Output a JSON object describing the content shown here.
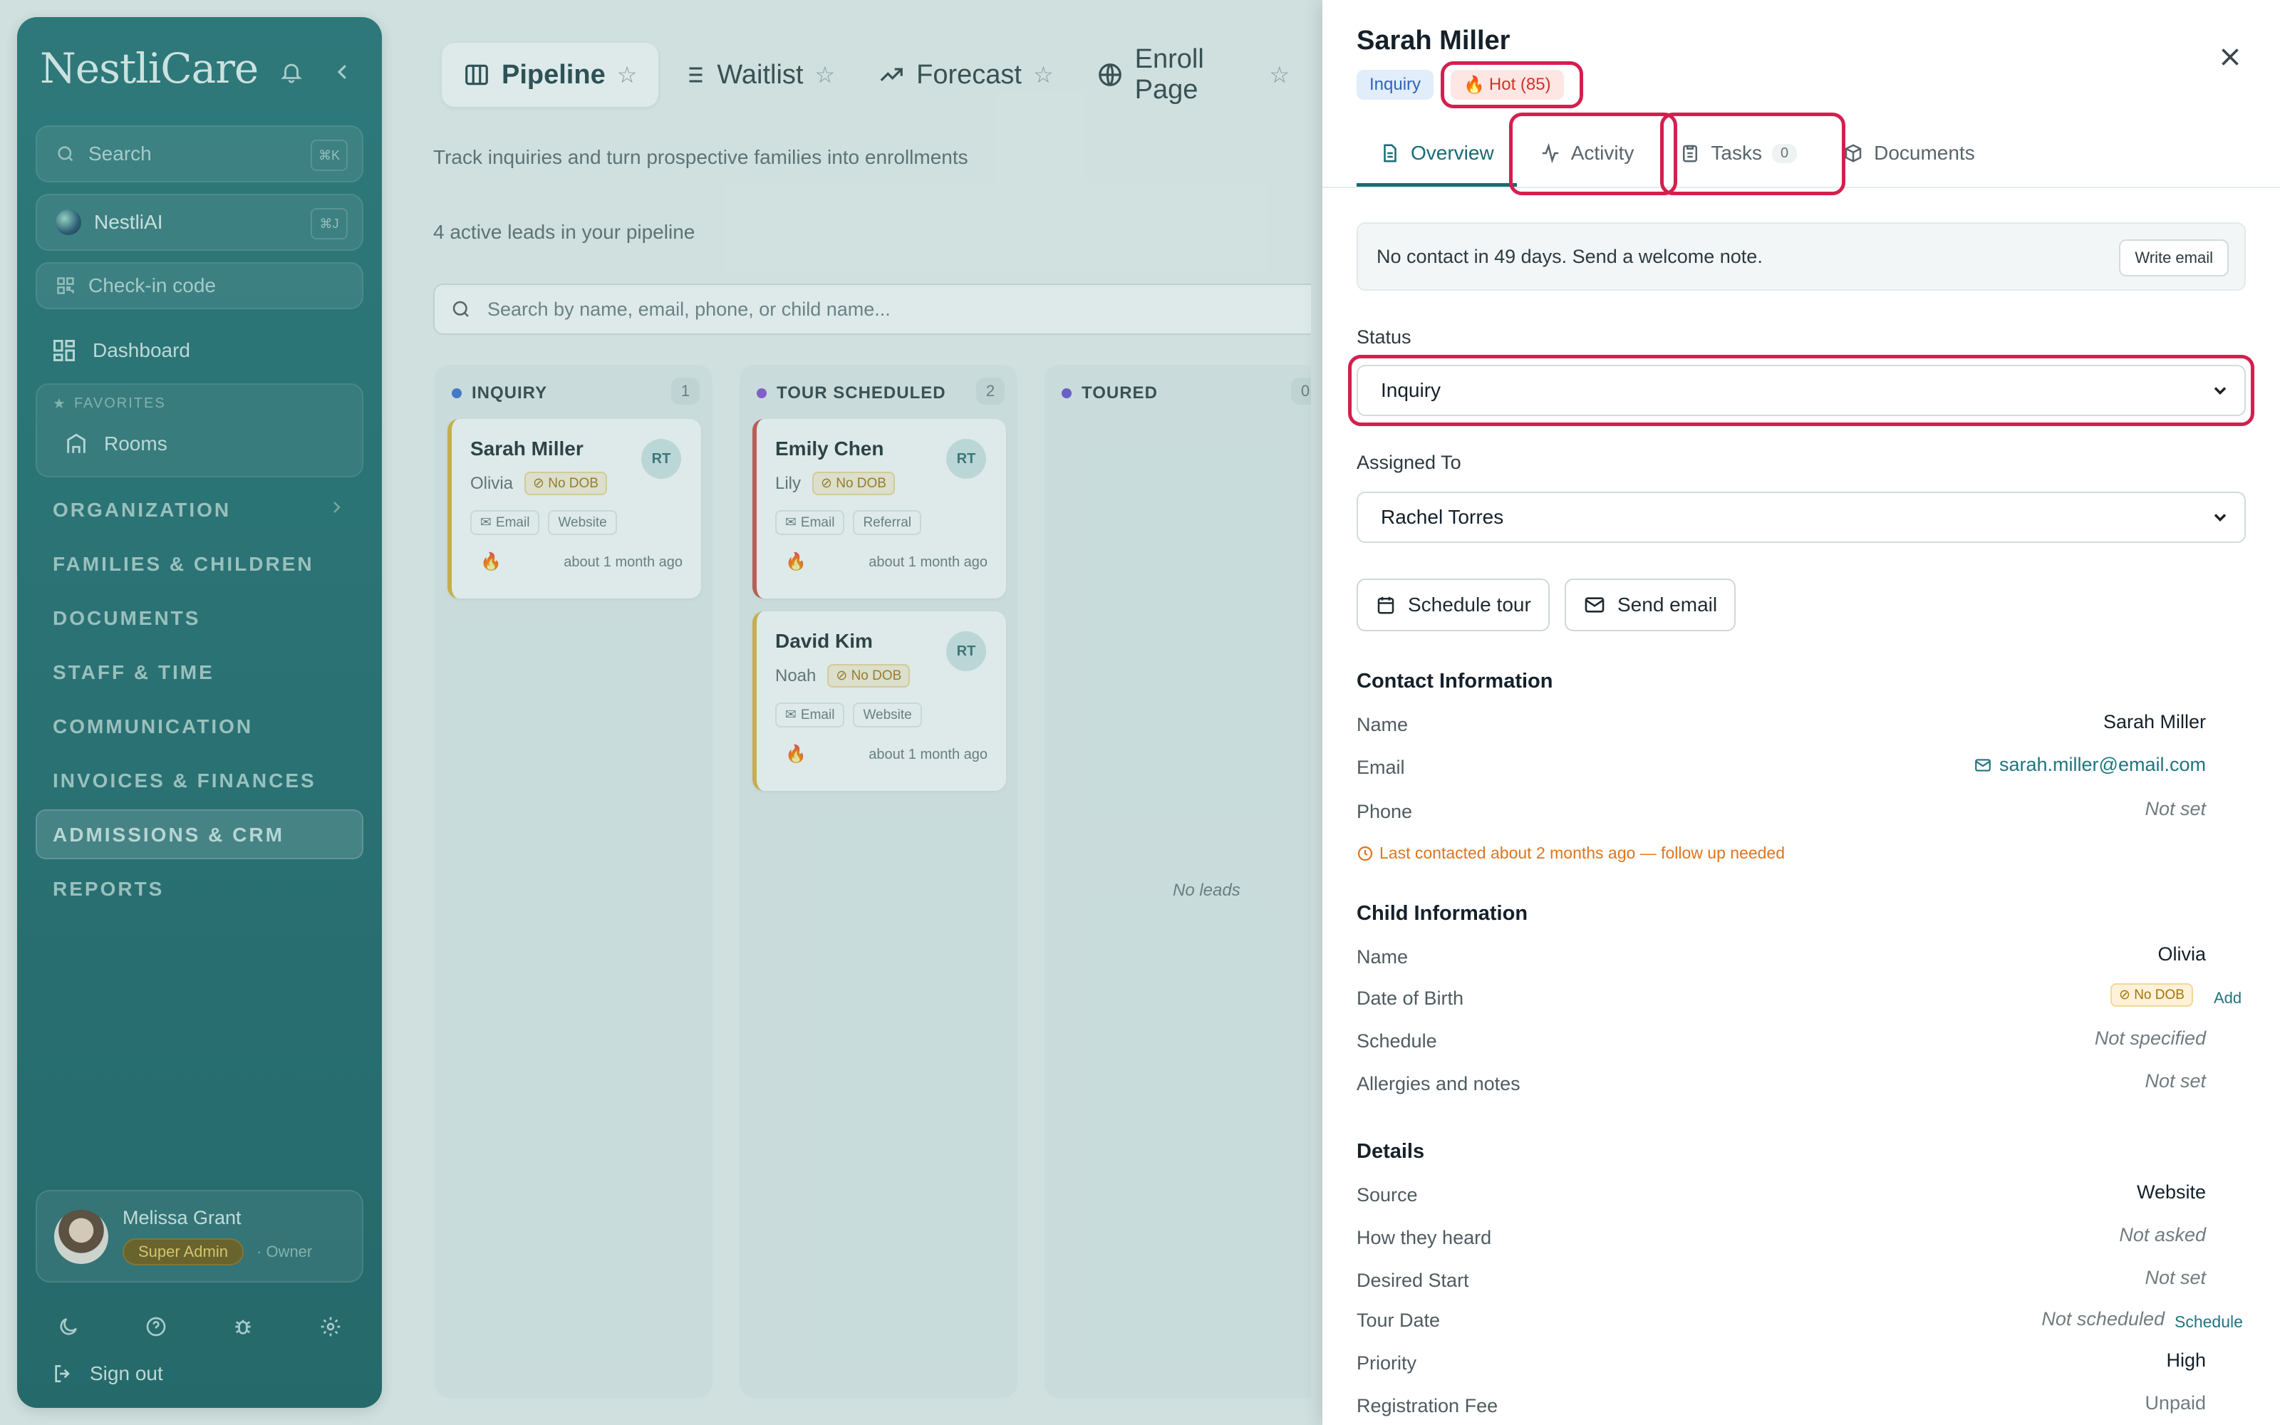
{
  "app": {
    "brand": "NestliCare"
  },
  "sidebar": {
    "search": {
      "label": "Search",
      "shortcut": "⌘K"
    },
    "ai": {
      "label": "NestliAI",
      "shortcut": "⌘J"
    },
    "checkin": {
      "label": "Check-in code"
    },
    "dashboard": "Dashboard",
    "favorites": {
      "title": "FAVORITES",
      "item": "Rooms"
    },
    "sections": [
      "ORGANIZATION",
      "FAMILIES & CHILDREN",
      "DOCUMENTS",
      "STAFF & TIME",
      "COMMUNICATION",
      "INVOICES & FINANCES",
      "ADMISSIONS & CRM",
      "REPORTS"
    ],
    "user": {
      "name": "Melissa Grant",
      "role": "Super Admin",
      "suffix": "· Owner"
    },
    "signout": "Sign out"
  },
  "main": {
    "tabs": [
      "Pipeline",
      "Waitlist",
      "Forecast",
      "Enroll Page"
    ],
    "subtitle": "Track inquiries and turn prospective families into enrollments",
    "count_line": "4 active leads in your pipeline",
    "search_placeholder": "Search by name, email, phone, or child name...",
    "columns": [
      {
        "title": "INQUIRY",
        "count": "1",
        "color": "#3b6fd1"
      },
      {
        "title": "TOUR SCHEDULED",
        "count": "2",
        "color": "#8a4fd1"
      },
      {
        "title": "TOURED",
        "count": "0",
        "color": "#6a4fcf"
      }
    ],
    "cards": [
      {
        "name": "Sarah Miller",
        "child": "Olivia",
        "dob": "No DOB",
        "tag1": "Email",
        "tag2": "Website",
        "initials": "RT",
        "time": "about 1 month ago"
      },
      {
        "name": "Emily Chen",
        "child": "Lily",
        "dob": "No DOB",
        "tag1": "Email",
        "tag2": "Referral",
        "initials": "RT",
        "time": "about 1 month ago"
      },
      {
        "name": "David Kim",
        "child": "Noah",
        "dob": "No DOB",
        "tag1": "Email",
        "tag2": "Website",
        "initials": "RT",
        "time": "about 1 month ago"
      }
    ],
    "no_leads": "No leads"
  },
  "drawer": {
    "title": "Sarah Miller",
    "badge_status": "Inquiry",
    "badge_hot": "Hot (85)",
    "tabs": {
      "overview": "Overview",
      "activity": "Activity",
      "tasks": "Tasks",
      "tasks_count": "0",
      "documents": "Documents"
    },
    "notice": {
      "text": "No contact in 49 days. Send a welcome note.",
      "button": "Write email"
    },
    "status": {
      "label": "Status",
      "value": "Inquiry"
    },
    "assigned": {
      "label": "Assigned To",
      "value": "Rachel Torres"
    },
    "actions": {
      "tour": "Schedule tour",
      "email": "Send email"
    },
    "contact": {
      "title": "Contact Information",
      "name_k": "Name",
      "name_v": "Sarah Miller",
      "email_k": "Email",
      "email_v": "sarah.miller@email.com",
      "phone_k": "Phone",
      "phone_v": "Not set",
      "warning": "Last contacted about 2 months ago — follow up needed"
    },
    "child": {
      "title": "Child Information",
      "name_k": "Name",
      "name_v": "Olivia",
      "dob_k": "Date of Birth",
      "dob_v": "No DOB",
      "dob_add": "Add",
      "schedule_k": "Schedule",
      "schedule_v": "Not specified",
      "allergies_k": "Allergies and notes",
      "allergies_v": "Not set"
    },
    "details": {
      "title": "Details",
      "source_k": "Source",
      "source_v": "Website",
      "heard_k": "How they heard",
      "heard_v": "Not asked",
      "start_k": "Desired Start",
      "start_v": "Not set",
      "tour_k": "Tour Date",
      "tour_v": "Not scheduled",
      "tour_link": "Schedule",
      "priority_k": "Priority",
      "priority_v": "High",
      "fee_k": "Registration Fee",
      "fee_v": "Unpaid"
    }
  },
  "colors": {
    "accent": "#176b74",
    "highlight": "#d41f4e",
    "sidebar": "#1c676b"
  }
}
